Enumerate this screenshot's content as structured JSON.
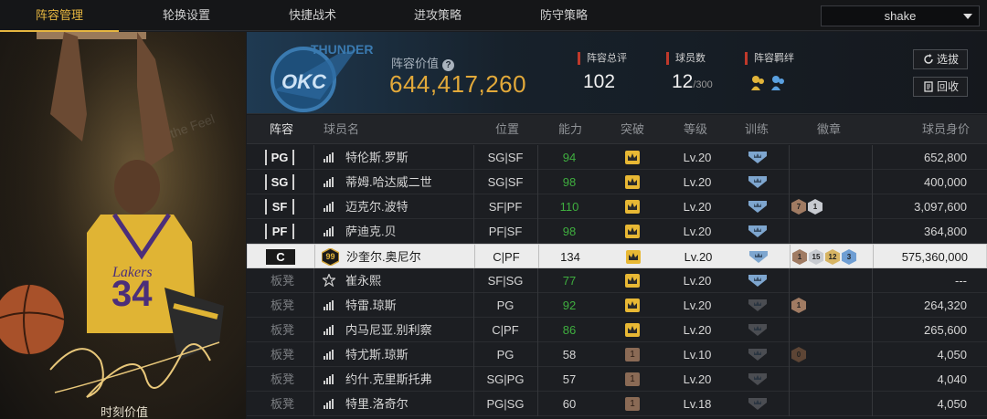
{
  "nav": {
    "tabs": [
      "阵容管理",
      "轮换设置",
      "快捷战术",
      "进攻策略",
      "防守策略"
    ],
    "active_index": 0,
    "dropdown_value": "shake"
  },
  "poster": {
    "caption": "时刻价值",
    "background_text": "the Feel"
  },
  "header": {
    "value_label": "阵容价值",
    "value_help_icon": "question-circle-icon",
    "value": "644,417,260",
    "total_rating_label": "阵容总评",
    "total_rating": "102",
    "player_count_label": "球员数",
    "player_count": "12",
    "player_count_max": "/300",
    "bond_label": "阵容羁绊",
    "select_button": "选拔",
    "recycle_button": "回收",
    "accent_color": "#e2a93a"
  },
  "table": {
    "headers": {
      "slot": "阵容",
      "name": "球员名",
      "position": "位置",
      "rating": "能力",
      "breakthrough": "突破",
      "level": "等级",
      "training": "训练",
      "badges": "徽章",
      "value": "球员身价"
    },
    "rows": [
      {
        "slot": "PG",
        "name": "特伦斯.罗斯",
        "pos": "SG|SF",
        "rating": "94",
        "level": "Lv.20",
        "value": "652,800"
      },
      {
        "slot": "SG",
        "name": "蒂姆.哈达威二世",
        "pos": "SG|SF",
        "rating": "98",
        "level": "Lv.20",
        "value": "400,000"
      },
      {
        "slot": "SF",
        "name": "迈克尔.波特",
        "pos": "SF|PF",
        "rating": "110",
        "level": "Lv.20",
        "value": "3,097,600",
        "badges": [
          "7",
          "1"
        ]
      },
      {
        "slot": "PF",
        "name": "萨迪克.贝",
        "pos": "PF|SF",
        "rating": "98",
        "level": "Lv.20",
        "value": "364,800"
      },
      {
        "slot": "C",
        "name": "沙奎尔.奥尼尔",
        "pos": "C|PF",
        "rating": "134",
        "level": "Lv.20",
        "value": "575,360,000",
        "tag": "99",
        "badges": [
          "1",
          "15",
          "12",
          "3"
        ]
      },
      {
        "slot": "板凳",
        "name": "崔永熙",
        "pos": "SF|SG",
        "rating": "77",
        "level": "Lv.20",
        "value": "---"
      },
      {
        "slot": "板凳",
        "name": "特雷.琼斯",
        "pos": "PG",
        "rating": "92",
        "level": "Lv.20",
        "value": "264,320",
        "badges": [
          "1"
        ]
      },
      {
        "slot": "板凳",
        "name": "内马尼亚.别利察",
        "pos": "C|PF",
        "rating": "86",
        "level": "Lv.20",
        "value": "265,600"
      },
      {
        "slot": "板凳",
        "name": "特尤斯.琼斯",
        "pos": "PG",
        "rating": "58",
        "level": "Lv.10",
        "value": "4,050",
        "breakthrough": "1",
        "badges": [
          "0"
        ]
      },
      {
        "slot": "板凳",
        "name": "约什.克里斯托弗",
        "pos": "SG|PG",
        "rating": "57",
        "level": "Lv.20",
        "value": "4,040",
        "breakthrough": "1"
      },
      {
        "slot": "板凳",
        "name": "特里.洛奇尔",
        "pos": "PG|SG",
        "rating": "60",
        "level": "Lv.18",
        "value": "4,050",
        "breakthrough": "1"
      }
    ]
  }
}
